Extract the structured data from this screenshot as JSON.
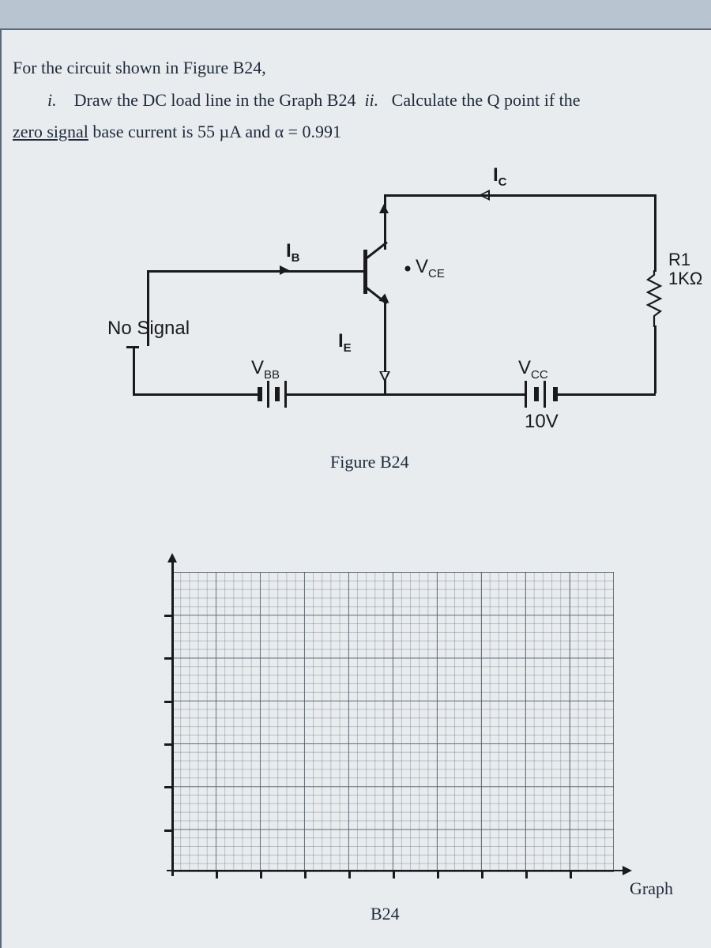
{
  "question": {
    "line1_prefix": "For the circuit shown in Figure B24,",
    "item_marker": "i.",
    "line2_a": "Draw the DC load line in the Graph B24",
    "item2_marker": "ii.",
    "line2_b": "Calculate the Q point if the",
    "line3_a": "zero signal",
    "line3_b": " base current is 55 µA and α = 0.991"
  },
  "circuit": {
    "Ic": "I",
    "Ic_sub": "C",
    "Ib": "I",
    "Ib_sub": "B",
    "Ie": "I",
    "Ie_sub": "E",
    "Vce": "V",
    "Vce_sub": "CE",
    "noSignal": "No Signal",
    "Vbb": "V",
    "Vbb_sub": "BB",
    "Vcc": "V",
    "Vcc_sub": "CC",
    "Vcc_val": "10V",
    "R1": "R1",
    "R1_val": "1KΩ",
    "caption": "Figure B24"
  },
  "graph": {
    "label_right": "Graph",
    "label_bottom": "B24"
  }
}
